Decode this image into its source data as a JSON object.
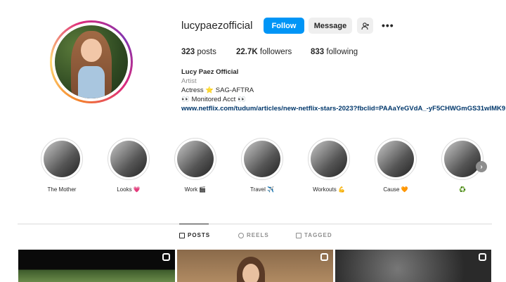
{
  "profile": {
    "username": "lucypaezofficial",
    "follow_label": "Follow",
    "message_label": "Message",
    "more_label": "•••"
  },
  "stats": {
    "posts_count": "323",
    "posts_label": "posts",
    "followers_count": "22.7K",
    "followers_label": "followers",
    "following_count": "833",
    "following_label": "following"
  },
  "bio": {
    "name": "Lucy Paez Official",
    "category": "Artist",
    "line1": "Actress ⭐ SAG-AFTRA",
    "line2": "👀 Monitored Acct 👀",
    "link": "www.netflix.com/tudum/articles/new-netflix-stars-2023?fbclid=PAAaYeGVdA_-yF5CHWGmGS31wlMK9"
  },
  "highlights": [
    {
      "label": "The Mother"
    },
    {
      "label": "Looks 💗"
    },
    {
      "label": "Work 🎬"
    },
    {
      "label": "Travel ✈️"
    },
    {
      "label": "Workouts 💪"
    },
    {
      "label": "Cause 🧡"
    },
    {
      "label": "♻️"
    }
  ],
  "tabs": {
    "posts": "POSTS",
    "reels": "REELS",
    "tagged": "TAGGED"
  },
  "colors": {
    "accent": "#0095f6",
    "link": "#00376b"
  }
}
